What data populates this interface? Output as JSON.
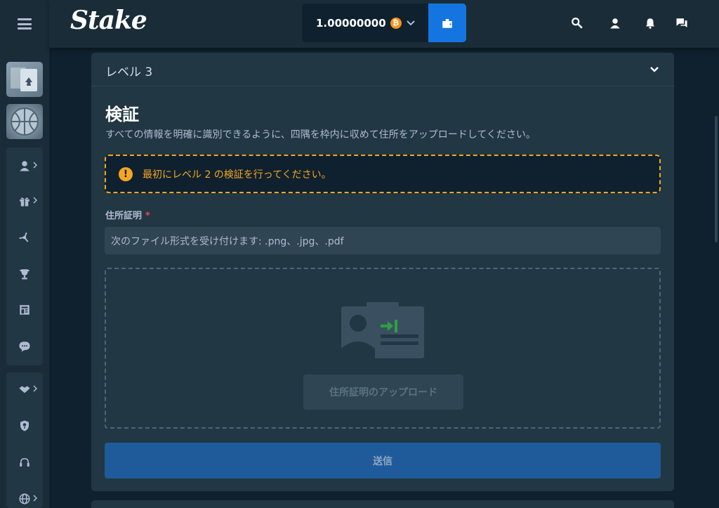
{
  "header": {
    "logo": "Stake",
    "balance": "1.00000000",
    "currency_symbol": "₿",
    "icons": [
      "search-icon",
      "user-icon",
      "bell-icon",
      "chat-icon"
    ]
  },
  "sidebar": {
    "thumbnails": [
      "casino",
      "sports"
    ],
    "group1_icons": [
      "user-icon",
      "gift-icon",
      "affiliate-icon",
      "trophy-icon",
      "blog-icon",
      "forum-icon"
    ],
    "group2_icons": [
      "sponsorship-icon",
      "shield-icon",
      "headset-icon",
      "globe-icon"
    ]
  },
  "accordion": {
    "title": "レベル 3"
  },
  "verification": {
    "title": "検証",
    "description": "すべての情報を明確に識別できるように、四隅を枠内に収めて住所をアップロードしてください。",
    "warning": "最初にレベル 2 の検証を行ってください。",
    "field_label": "住所証明",
    "required_mark": "*",
    "file_hint": "次のファイル形式を受け付けます: .png、.jpg、.pdf",
    "upload_button": "住所証明のアップロード",
    "submit_button": "送信"
  },
  "colors": {
    "background": "#0f212e",
    "panel": "#213743",
    "accent": "#1475e1",
    "warning": "#f5a623",
    "required": "#ed4163"
  }
}
